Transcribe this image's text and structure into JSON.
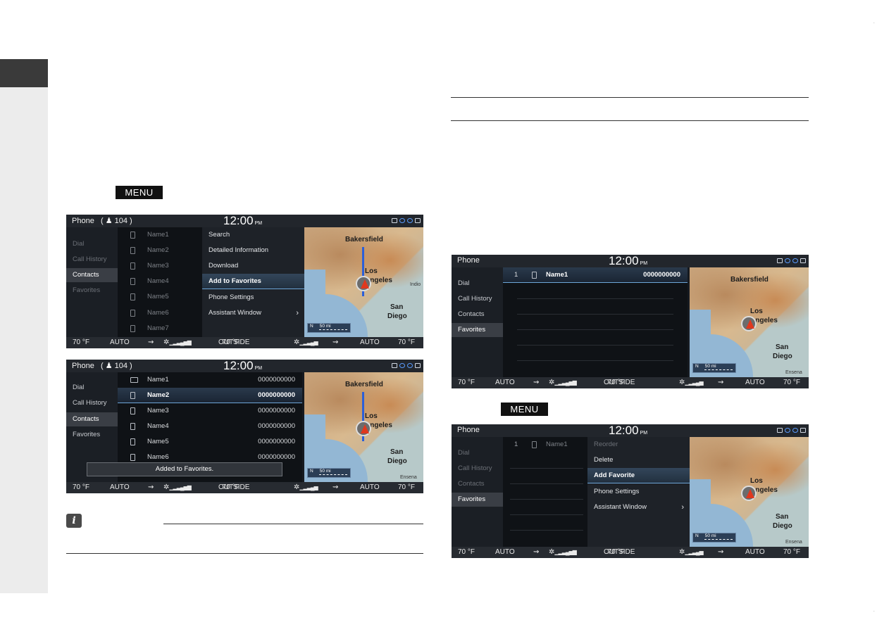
{
  "page": {
    "menu_key": "MENU"
  },
  "common": {
    "time": "12:00",
    "pm": "PM",
    "footer": {
      "left_temp": "70 °F",
      "auto_left": "AUTO",
      "outside": "OUTSIDE",
      "outside_temp": "70 °F",
      "auto_right": "AUTO",
      "right_temp": "70 °F"
    },
    "map": {
      "bakersfield": "Bakersfield",
      "los": "Los",
      "angeles": "Angeles",
      "san": "San",
      "diego": "Diego",
      "indio": "Indio",
      "ensenada": "Ensena",
      "scale": "50 mi",
      "north": "N"
    }
  },
  "screen1": {
    "title": "Phone",
    "count": "( ♟ 104 )",
    "nav": [
      "Dial",
      "Call History",
      "Contacts",
      "Favorites"
    ],
    "contacts": [
      "Name1",
      "Name2",
      "Name3",
      "Name4",
      "Name5",
      "Name6",
      "Name7"
    ],
    "menu": [
      "Search",
      "Detailed Information",
      "Download",
      "Add to Favorites",
      "Phone Settings",
      "Assistant Window"
    ],
    "arrow": "›"
  },
  "screen2": {
    "title": "Phone",
    "count": "( ♟ 104 )",
    "nav": [
      "Dial",
      "Call History",
      "Contacts",
      "Favorites"
    ],
    "rows": [
      {
        "name": "Name1",
        "number": "0000000000"
      },
      {
        "name": "Name2",
        "number": "0000000000"
      },
      {
        "name": "Name3",
        "number": "0000000000"
      },
      {
        "name": "Name4",
        "number": "0000000000"
      },
      {
        "name": "Name5",
        "number": "0000000000"
      },
      {
        "name": "Name6",
        "number": "0000000000"
      }
    ],
    "toast": "Added to Favorites."
  },
  "screen3": {
    "title": "Phone",
    "nav": [
      "Dial",
      "Call History",
      "Contacts",
      "Favorites"
    ],
    "row": {
      "index": "1",
      "name": "Name1",
      "number": "0000000000"
    }
  },
  "screen4": {
    "title": "Phone",
    "nav": [
      "Dial",
      "Call History",
      "Contacts",
      "Favorites"
    ],
    "row": {
      "index": "1",
      "name": "Name1"
    },
    "menu": [
      "Reorder",
      "Delete",
      "Add Favorite",
      "Phone Settings",
      "Assistant Window"
    ],
    "arrow": "›"
  }
}
